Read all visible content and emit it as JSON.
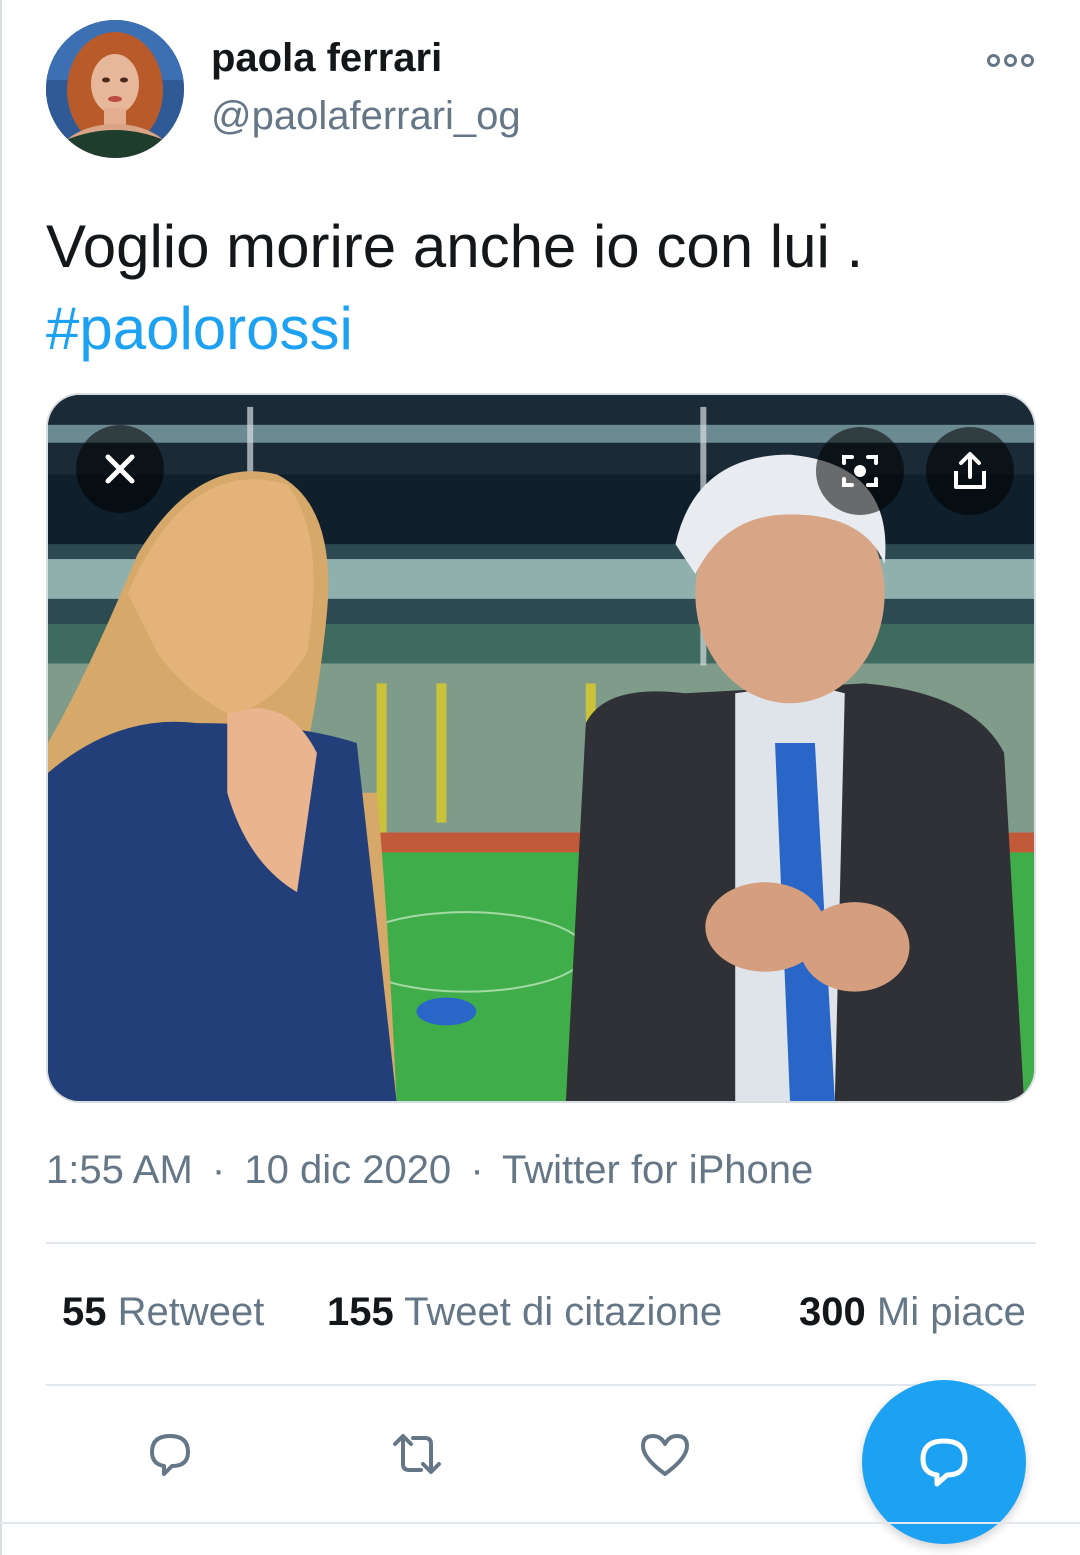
{
  "author": {
    "display_name": "paola ferrari",
    "username": "@paolaferrari_og"
  },
  "tweet": {
    "text": "Voglio morire anche io con lui .",
    "hashtag": "#paolorossi"
  },
  "meta": {
    "time": "1:55 AM",
    "date": "10 dic 2020",
    "source": "Twitter for iPhone",
    "separator": "·"
  },
  "stats": {
    "retweets_count": "55",
    "retweets_label": "Retweet",
    "quotes_count": "155",
    "quotes_label": "Tweet di citazione",
    "likes_count": "300",
    "likes_label": "Mi piace"
  },
  "icons": {
    "more": "more-options-icon",
    "close": "close-icon",
    "lens": "lens-search-icon",
    "share": "share-icon",
    "reply": "reply-icon",
    "retweet": "retweet-icon",
    "like": "heart-icon",
    "compose_reply": "reply-fab-icon"
  },
  "colors": {
    "accent": "#1da1f2",
    "text": "#14171a",
    "secondary": "#657786"
  }
}
